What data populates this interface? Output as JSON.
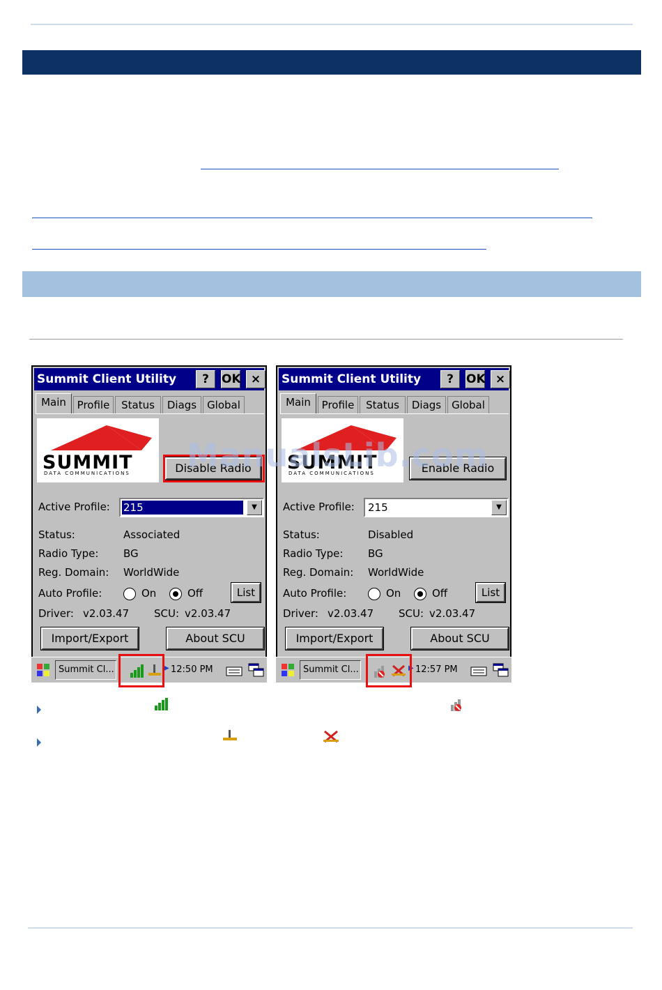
{
  "window": {
    "title": "Summit Client Utility",
    "help_label": "?",
    "ok_label": "OK",
    "close_label": "×"
  },
  "tabs": [
    "Main",
    "Profile",
    "Status",
    "Diags",
    "Global"
  ],
  "logo": {
    "brand": "SUMMIT",
    "sub": "DATA COMMUNICATIONS"
  },
  "labels": {
    "active_profile": "Active Profile:",
    "status": "Status:",
    "radio_type": "Radio Type:",
    "reg_domain": "Reg. Domain:",
    "auto_profile": "Auto Profile:",
    "on": "On",
    "off": "Off",
    "list": "List",
    "driver": "Driver:",
    "scu": "SCU:",
    "import_export": "Import/Export",
    "about_scu": "About SCU"
  },
  "left": {
    "radio_button": "Disable Radio",
    "active_profile": "215",
    "status": "Associated",
    "radio_type": "BG",
    "reg_domain": "WorldWide",
    "driver": "v2.03.47",
    "scu": "v2.03.47",
    "task": "Summit Cl...",
    "time": "12:50 PM"
  },
  "right": {
    "radio_button": "Enable Radio",
    "active_profile": "215",
    "status": "Disabled",
    "radio_type": "BG",
    "reg_domain": "WorldWide",
    "driver": "v2.03.47",
    "scu": "v2.03.47",
    "task": "Summit Cl...",
    "time": "12:57 PM"
  },
  "watermark": "ManualsLib.com",
  "colors": {
    "header_dark": "#0b3262",
    "header_light": "#a4c2e0",
    "titlebar": "#000088",
    "highlight": "#e81010"
  }
}
